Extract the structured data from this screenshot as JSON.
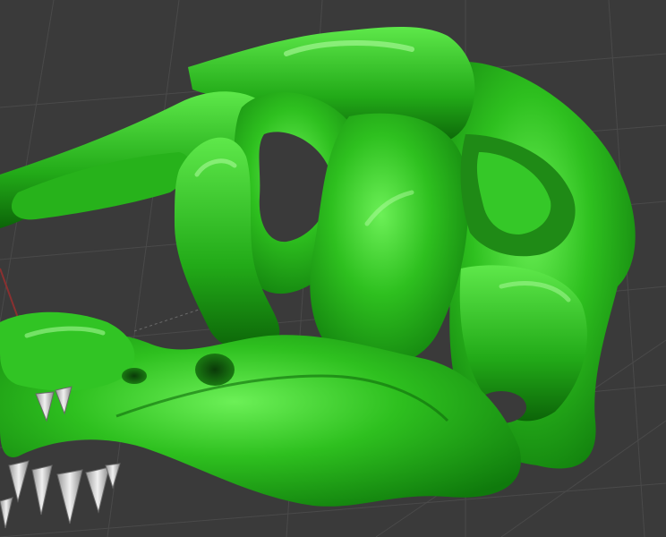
{
  "viewport": {
    "background_color": "#3a3a3a",
    "grid_line_color": "#4a4a4a",
    "axis_x_color": "#8a3030",
    "model_color": "#2bc21e",
    "model_highlight_color": "#7ef06a",
    "model_shadow_color": "#0d6a0a",
    "teeth_color": "#d8d8d8"
  }
}
